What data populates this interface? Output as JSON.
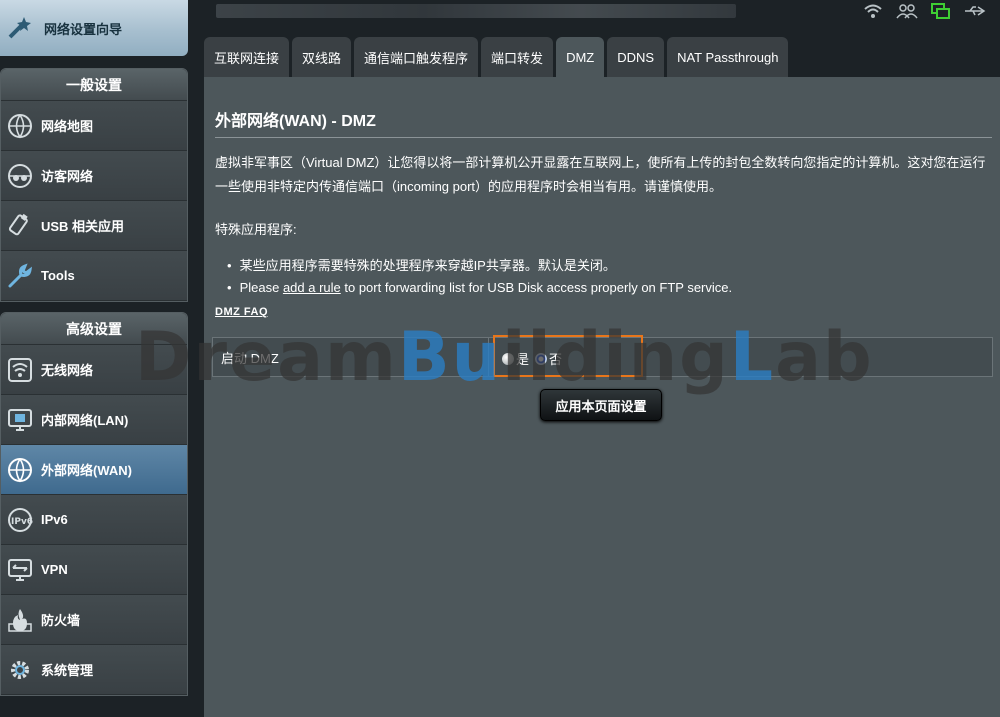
{
  "sidebar": {
    "wizard_label": "网络设置向导",
    "general_title": "一般设置",
    "general_items": [
      {
        "label": "网络地图",
        "icon": "globe-icon"
      },
      {
        "label": "访客网络",
        "icon": "guest-network-icon"
      },
      {
        "label": "USB 相关应用",
        "icon": "usb-icon"
      },
      {
        "label": "Tools",
        "icon": "wrench-icon"
      }
    ],
    "advanced_title": "高级设置",
    "advanced_items": [
      {
        "label": "无线网络",
        "icon": "wifi-icon"
      },
      {
        "label": "内部网络(LAN)",
        "icon": "lan-icon"
      },
      {
        "label": "外部网络(WAN)",
        "icon": "globe-icon",
        "active": true
      },
      {
        "label": "IPv6",
        "icon": "ipv6-icon"
      },
      {
        "label": "VPN",
        "icon": "vpn-icon"
      },
      {
        "label": "防火墙",
        "icon": "firewall-icon"
      },
      {
        "label": "系统管理",
        "icon": "gear-icon"
      }
    ]
  },
  "tabs": [
    "互联网连接",
    "双线路",
    "通信端口触发程序",
    "端口转发",
    "DMZ",
    "DDNS",
    "NAT Passthrough"
  ],
  "active_tab": "DMZ",
  "page": {
    "title": "外部网络(WAN) - DMZ",
    "description": "虚拟非军事区（Virtual DMZ）让您得以将一部计算机公开显露在互联网上，使所有上传的封包全数转向您指定的计算机。这对您在运行一些使用非特定内传通信端口（incoming port）的应用程序时会相当有用。请谨慎使用。",
    "special_heading": "特殊应用程序:",
    "bullet1": "某些应用程序需要特殊的处理程序来穿越IP共享器。默认是关闭。",
    "bullet2_pre": "Please ",
    "bullet2_link": "add a rule",
    "bullet2_post": " to port forwarding list for USB Disk access properly on FTP service.",
    "faq_link": "DMZ  FAQ",
    "enable_label": "启动 DMZ",
    "radio_yes": "是",
    "radio_no": "否",
    "selected": "否",
    "apply_button": "应用本页面设置"
  },
  "watermark": {
    "p1": "Dream",
    "p2": "Bu",
    "p3": "ilding",
    "p4": "L",
    "p5": "ab"
  },
  "status_icons": [
    "wifi-status-icon",
    "users-icon",
    "network-status-icon",
    "usb-status-icon"
  ],
  "colors": {
    "panel": "#4d575b",
    "active_item": "#4f799b",
    "highlight": "#e8761b",
    "radio_on": "#1d4fd8"
  }
}
